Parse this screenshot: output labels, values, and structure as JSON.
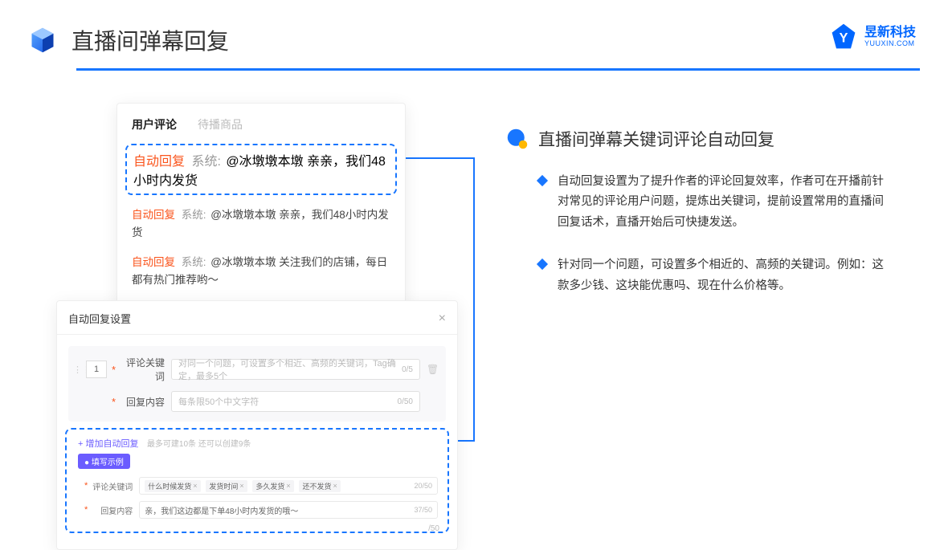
{
  "header": {
    "title": "直播间弹幕回复",
    "logo_cn": "昱新科技",
    "logo_en": "YUUXIN.COM"
  },
  "comments": {
    "tab_active": "用户评论",
    "tab_other": "待播商品",
    "rows": [
      {
        "tag": "自动回复",
        "sys": "系统:",
        "text": "@冰墩墩本墩 亲亲，我们48小时内发货"
      },
      {
        "tag": "自动回复",
        "sys": "系统:",
        "text": "@冰墩墩本墩 亲亲，我们48小时内发货"
      },
      {
        "tag": "自动回复",
        "sys": "系统:",
        "text": "@冰墩墩本墩 关注我们的店铺，每日都有热门推荐哟～"
      }
    ]
  },
  "settings": {
    "title": "自动回复设置",
    "num": "1",
    "kw_label": "评论关键词",
    "kw_placeholder": "对同一个问题，可设置多个相近、高频的关键词，Tag确定，最多5个",
    "kw_count": "0/5",
    "content_label": "回复内容",
    "content_placeholder": "每条限50个中文字符",
    "content_count": "0/50",
    "add_link": "+ 增加自动回复",
    "add_hint": "最多可建10条 还可以创建9条",
    "example_tag": "● 填写示例",
    "ex_kw_label": "评论关键词",
    "ex_tags": [
      "什么时候发货",
      "发货时间",
      "多久发货",
      "还不发货"
    ],
    "ex_kw_count": "20/50",
    "ex_content_label": "回复内容",
    "ex_content_value": "亲，我们这边都是下单48小时内发货的哦～",
    "ex_content_count": "37/50",
    "extra_count": "/50"
  },
  "right": {
    "title": "直播间弹幕关键词评论自动回复",
    "bullets": [
      "自动回复设置为了提升作者的评论回复效率，作者可在开播前针对常见的评论用户问题，提炼出关键词，提前设置常用的直播间回复话术，直播开始后可快捷发送。",
      "针对同一个问题，可设置多个相近的、高频的关键词。例如：这款多少钱、这块能优惠吗、现在什么价格等。"
    ]
  }
}
